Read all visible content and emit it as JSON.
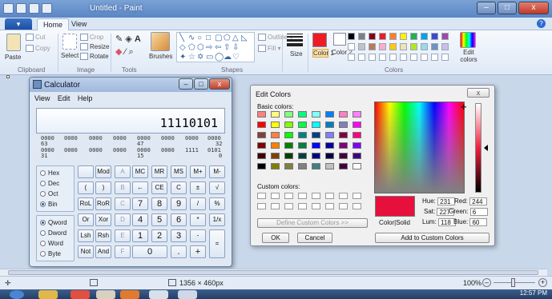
{
  "window": {
    "title": "Untitled - Paint",
    "controls": [
      "–",
      "□",
      "x"
    ]
  },
  "ribbon": {
    "file_label": "",
    "tabs": [
      "Home",
      "View"
    ],
    "clipboard": {
      "paste": "Paste",
      "cut": "Cut",
      "copy": "Copy",
      "label": "Clipboard"
    },
    "image": {
      "select": "Select",
      "crop": "Crop",
      "resize": "Resize",
      "rotate": "Rotate",
      "label": "Image"
    },
    "tools": {
      "label": "Tools",
      "brushes": "Brushes"
    },
    "shapes": {
      "outline": "Outline",
      "fill": "Fill",
      "label": "Shapes"
    },
    "size": "Size",
    "color1": "Color 1",
    "color2": "Color 2",
    "edit_colors": "Edit colors",
    "colors_label": "Colors",
    "palette": [
      "#000000",
      "#7f7f7f",
      "#880015",
      "#ed1c24",
      "#ff7f27",
      "#fff200",
      "#22b14c",
      "#00a2e8",
      "#3f48cc",
      "#a349a4",
      "#ffffff",
      "#c3c3c3",
      "#b97a57",
      "#ffaec9",
      "#ffc90e",
      "#efe4b0",
      "#b5e61d",
      "#99d9ea",
      "#7092be",
      "#c8bfe7"
    ],
    "accent_color1": "#ed1c24"
  },
  "calculator": {
    "title": "Calculator",
    "menu": [
      "View",
      "Edit",
      "Help"
    ],
    "display": "11110101",
    "bits_row1": [
      "0000",
      "0000",
      "0000",
      "0000",
      "0000",
      "0000",
      "0000",
      "0000"
    ],
    "bits_row1_idx": [
      "63",
      "47",
      "32"
    ],
    "bits_row2": [
      "0000",
      "0000",
      "0000",
      "0000",
      "0000",
      "0000",
      "1111",
      "0101"
    ],
    "bits_row2_idx": [
      "31",
      "15",
      "0"
    ],
    "radix": [
      "Hex",
      "Dec",
      "Oct",
      "Bin"
    ],
    "radix_selected": "Bin",
    "word": [
      "Qword",
      "Dword",
      "Word",
      "Byte"
    ],
    "word_selected": "Qword",
    "keys": {
      "r1": [
        "",
        "Mod",
        "A",
        "MC",
        "MR",
        "MS",
        "M+",
        "M-"
      ],
      "r2": [
        "(",
        ")",
        "B",
        "←",
        "CE",
        "C",
        "±",
        "√"
      ],
      "r3": [
        "RoL",
        "RoR",
        "C",
        "7",
        "8",
        "9",
        "/",
        "%"
      ],
      "r4": [
        "Or",
        "Xor",
        "D",
        "4",
        "5",
        "6",
        "*",
        "1/x"
      ],
      "r5": [
        "Lsh",
        "Rsh",
        "E",
        "1",
        "2",
        "3",
        "-",
        "="
      ],
      "r6": [
        "Not",
        "And",
        "F",
        "0",
        ".",
        "+"
      ]
    }
  },
  "edit_colors": {
    "title": "Edit Colors",
    "close": "x",
    "basic_label": "Basic colors:",
    "custom_label": "Custom colors:",
    "define_btn": "Define Custom Colors >>",
    "ok": "OK",
    "cancel": "Cancel",
    "add_btn": "Add to Custom Colors",
    "color_solid": "Color|Solid",
    "hue_label": "Hue:",
    "hue": "231",
    "sat_label": "Sat:",
    "sat": "227",
    "lum_label": "Lum:",
    "lum": "118",
    "red_label": "Red:",
    "red": "244",
    "green_label": "Green:",
    "green": "6",
    "blue_label": "Blue:",
    "blue": "60",
    "selected_color": "#e70f3c",
    "basic_colors": [
      "#ff8080",
      "#ffff80",
      "#80ff80",
      "#00ff80",
      "#80ffff",
      "#0080ff",
      "#ff80c0",
      "#ff80ff",
      "#ff0000",
      "#ffff00",
      "#80ff00",
      "#00ff40",
      "#00ffff",
      "#0080c0",
      "#8080c0",
      "#ff00ff",
      "#804040",
      "#ff8040",
      "#00ff00",
      "#008080",
      "#004080",
      "#8080ff",
      "#800040",
      "#ff0080",
      "#800000",
      "#ff8000",
      "#008000",
      "#008040",
      "#0000ff",
      "#0000a0",
      "#800080",
      "#8000ff",
      "#400000",
      "#804000",
      "#004000",
      "#004040",
      "#000080",
      "#000040",
      "#400040",
      "#400080",
      "#000000",
      "#808000",
      "#808040",
      "#808080",
      "#408080",
      "#c0c0c0",
      "#400040",
      "#ffffff"
    ]
  },
  "status": {
    "dimensions": "1356 × 460px",
    "zoom": "100%"
  },
  "taskbar": {
    "time": "12:57 PM"
  }
}
